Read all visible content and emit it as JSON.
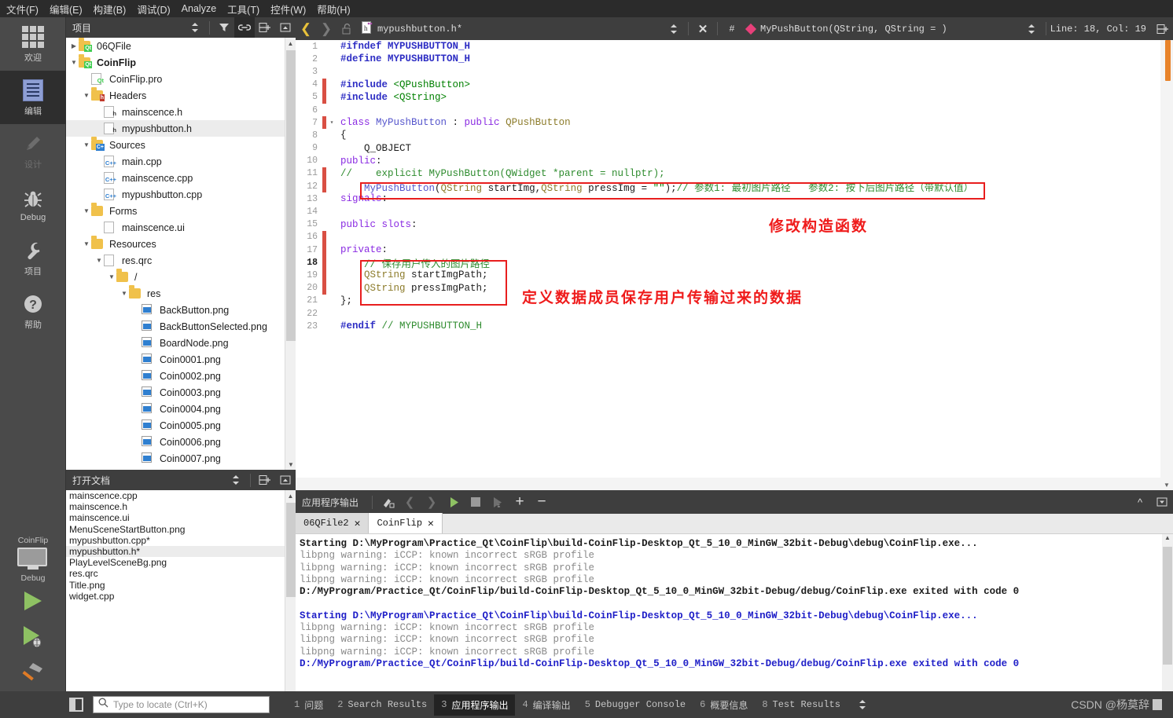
{
  "menubar": [
    {
      "label": "文件(F)"
    },
    {
      "label": "编辑(E)"
    },
    {
      "label": "构建(B)"
    },
    {
      "label": "调试(D)"
    },
    {
      "label": "Analyze"
    },
    {
      "label": "工具(T)"
    },
    {
      "label": "控件(W)"
    },
    {
      "label": "帮助(H)"
    }
  ],
  "modebar": {
    "items": [
      {
        "label": "欢迎",
        "icon": "grid-icon"
      },
      {
        "label": "编辑",
        "icon": "edit-icon"
      },
      {
        "label": "设计",
        "icon": "pencil-icon"
      },
      {
        "label": "Debug",
        "icon": "bug-icon"
      },
      {
        "label": "项目",
        "icon": "wrench-icon"
      },
      {
        "label": "帮助",
        "icon": "question-icon"
      }
    ],
    "kit": {
      "project": "CoinFlip",
      "build_config": "Debug"
    }
  },
  "project_pane": {
    "title": "项目",
    "tree": [
      {
        "indent": 0,
        "arrow": "right",
        "icon": "qt-folder",
        "label": "06QFile",
        "bold": false,
        "sel": false
      },
      {
        "indent": 0,
        "arrow": "down",
        "icon": "qt-folder",
        "label": "CoinFlip",
        "bold": true,
        "sel": false
      },
      {
        "indent": 1,
        "arrow": "",
        "icon": "qt-file",
        "label": "CoinFlip.pro",
        "bold": false,
        "sel": false
      },
      {
        "indent": 1,
        "arrow": "down",
        "icon": "h-folder",
        "label": "Headers",
        "bold": false,
        "sel": false
      },
      {
        "indent": 2,
        "arrow": "",
        "icon": "h-file",
        "label": "mainscence.h",
        "bold": false,
        "sel": false
      },
      {
        "indent": 2,
        "arrow": "",
        "icon": "h-file",
        "label": "mypushbutton.h",
        "bold": false,
        "sel": true
      },
      {
        "indent": 1,
        "arrow": "down",
        "icon": "cpp-folder",
        "label": "Sources",
        "bold": false,
        "sel": false
      },
      {
        "indent": 2,
        "arrow": "",
        "icon": "cpp-file",
        "label": "main.cpp",
        "bold": false,
        "sel": false
      },
      {
        "indent": 2,
        "arrow": "",
        "icon": "cpp-file",
        "label": "mainscence.cpp",
        "bold": false,
        "sel": false
      },
      {
        "indent": 2,
        "arrow": "",
        "icon": "cpp-file",
        "label": "mypushbutton.cpp",
        "bold": false,
        "sel": false
      },
      {
        "indent": 1,
        "arrow": "down",
        "icon": "form-folder",
        "label": "Forms",
        "bold": false,
        "sel": false
      },
      {
        "indent": 2,
        "arrow": "",
        "icon": "ui-file",
        "label": "mainscence.ui",
        "bold": false,
        "sel": false
      },
      {
        "indent": 1,
        "arrow": "down",
        "icon": "res-folder",
        "label": "Resources",
        "bold": false,
        "sel": false
      },
      {
        "indent": 2,
        "arrow": "down",
        "icon": "qrc-file",
        "label": "res.qrc",
        "bold": false,
        "sel": false
      },
      {
        "indent": 3,
        "arrow": "down",
        "icon": "plain-folder",
        "label": "/",
        "bold": false,
        "sel": false
      },
      {
        "indent": 4,
        "arrow": "down",
        "icon": "plain-folder",
        "label": "res",
        "bold": false,
        "sel": false
      },
      {
        "indent": 5,
        "arrow": "",
        "icon": "png-file",
        "label": "BackButton.png",
        "bold": false,
        "sel": false
      },
      {
        "indent": 5,
        "arrow": "",
        "icon": "png-file",
        "label": "BackButtonSelected.png",
        "bold": false,
        "sel": false
      },
      {
        "indent": 5,
        "arrow": "",
        "icon": "png-file",
        "label": "BoardNode.png",
        "bold": false,
        "sel": false
      },
      {
        "indent": 5,
        "arrow": "",
        "icon": "png-file",
        "label": "Coin0001.png",
        "bold": false,
        "sel": false
      },
      {
        "indent": 5,
        "arrow": "",
        "icon": "png-file",
        "label": "Coin0002.png",
        "bold": false,
        "sel": false
      },
      {
        "indent": 5,
        "arrow": "",
        "icon": "png-file",
        "label": "Coin0003.png",
        "bold": false,
        "sel": false
      },
      {
        "indent": 5,
        "arrow": "",
        "icon": "png-file",
        "label": "Coin0004.png",
        "bold": false,
        "sel": false
      },
      {
        "indent": 5,
        "arrow": "",
        "icon": "png-file",
        "label": "Coin0005.png",
        "bold": false,
        "sel": false
      },
      {
        "indent": 5,
        "arrow": "",
        "icon": "png-file",
        "label": "Coin0006.png",
        "bold": false,
        "sel": false
      },
      {
        "indent": 5,
        "arrow": "",
        "icon": "png-file",
        "label": "Coin0007.png",
        "bold": false,
        "sel": false
      }
    ]
  },
  "open_documents": {
    "title": "打开文档",
    "items": [
      {
        "label": "mainscence.cpp",
        "sel": false
      },
      {
        "label": "mainscence.h",
        "sel": false
      },
      {
        "label": "mainscence.ui",
        "sel": false
      },
      {
        "label": "MenuSceneStartButton.png",
        "sel": false
      },
      {
        "label": "mypushbutton.cpp*",
        "sel": false
      },
      {
        "label": "mypushbutton.h*",
        "sel": true
      },
      {
        "label": "PlayLevelSceneBg.png",
        "sel": false
      },
      {
        "label": "res.qrc",
        "sel": false
      },
      {
        "label": "Title.png",
        "sel": false
      },
      {
        "label": "widget.cpp",
        "sel": false
      }
    ]
  },
  "editor_toolbar": {
    "filename": "mypushbutton.h*",
    "hash": "#",
    "symbol": "MyPushButton(QString, QString = )",
    "line_col": "Line: 18, Col: 19"
  },
  "code": {
    "lines": [
      {
        "n": "1",
        "modified": false,
        "fold": "",
        "current": false,
        "tokens": [
          {
            "t": "#ifndef MYPUSHBUTTON_H",
            "c": "pre"
          }
        ]
      },
      {
        "n": "2",
        "modified": false,
        "fold": "",
        "current": false,
        "tokens": [
          {
            "t": "#define MYPUSHBUTTON_H",
            "c": "pre"
          }
        ]
      },
      {
        "n": "3",
        "modified": false,
        "fold": "",
        "current": false,
        "tokens": [
          {
            "t": "",
            "c": "var"
          }
        ]
      },
      {
        "n": "4",
        "modified": true,
        "fold": "",
        "current": false,
        "tokens": [
          {
            "t": "#include ",
            "c": "pre"
          },
          {
            "t": "<QPushButton>",
            "c": "str"
          }
        ]
      },
      {
        "n": "5",
        "modified": true,
        "fold": "",
        "current": false,
        "tokens": [
          {
            "t": "#include ",
            "c": "pre"
          },
          {
            "t": "<QString>",
            "c": "str"
          }
        ]
      },
      {
        "n": "6",
        "modified": false,
        "fold": "",
        "current": false,
        "tokens": [
          {
            "t": "",
            "c": "var"
          }
        ]
      },
      {
        "n": "7",
        "modified": true,
        "fold": "▾",
        "current": false,
        "tokens": [
          {
            "t": "class ",
            "c": "kw"
          },
          {
            "t": "MyPushButton",
            "c": "cls"
          },
          {
            "t": " : ",
            "c": "var"
          },
          {
            "t": "public ",
            "c": "kw"
          },
          {
            "t": "QPushButton",
            "c": "typ"
          }
        ]
      },
      {
        "n": "8",
        "modified": false,
        "fold": "",
        "current": false,
        "tokens": [
          {
            "t": "{",
            "c": "var"
          }
        ]
      },
      {
        "n": "9",
        "modified": false,
        "fold": "",
        "current": false,
        "tokens": [
          {
            "t": "    Q_OBJECT",
            "c": "var"
          }
        ]
      },
      {
        "n": "10",
        "modified": false,
        "fold": "",
        "current": false,
        "tokens": [
          {
            "t": "public",
            "c": "kw"
          },
          {
            "t": ":",
            "c": "var"
          }
        ]
      },
      {
        "n": "11",
        "modified": true,
        "fold": "",
        "current": false,
        "tokens": [
          {
            "t": "//    explicit MyPushButton(QWidget *parent = nullptr);",
            "c": "cmt"
          }
        ]
      },
      {
        "n": "12",
        "modified": true,
        "fold": "",
        "current": false,
        "tokens": [
          {
            "t": "    ",
            "c": "var"
          },
          {
            "t": "MyPushButton",
            "c": "cls"
          },
          {
            "t": "(",
            "c": "var"
          },
          {
            "t": "QString",
            "c": "typ"
          },
          {
            "t": " startImg,",
            "c": "var"
          },
          {
            "t": "QString",
            "c": "typ"
          },
          {
            "t": " pressImg = ",
            "c": "var"
          },
          {
            "t": "\"\"",
            "c": "str"
          },
          {
            "t": ");",
            "c": "var"
          },
          {
            "t": "// 参数1: 最初图片路径   参数2: 按下后图片路径（带默认值）",
            "c": "cmt"
          }
        ]
      },
      {
        "n": "13",
        "modified": false,
        "fold": "",
        "current": false,
        "tokens": [
          {
            "t": "signals",
            "c": "kw"
          },
          {
            "t": ":",
            "c": "var"
          }
        ]
      },
      {
        "n": "14",
        "modified": false,
        "fold": "",
        "current": false,
        "tokens": [
          {
            "t": "",
            "c": "var"
          }
        ]
      },
      {
        "n": "15",
        "modified": false,
        "fold": "",
        "current": false,
        "tokens": [
          {
            "t": "public slots",
            "c": "kw"
          },
          {
            "t": ":",
            "c": "var"
          }
        ]
      },
      {
        "n": "16",
        "modified": true,
        "fold": "",
        "current": false,
        "tokens": [
          {
            "t": "",
            "c": "var"
          }
        ]
      },
      {
        "n": "17",
        "modified": true,
        "fold": "",
        "current": false,
        "tokens": [
          {
            "t": "private",
            "c": "kw"
          },
          {
            "t": ":",
            "c": "var"
          }
        ]
      },
      {
        "n": "18",
        "modified": true,
        "fold": "",
        "current": true,
        "tokens": [
          {
            "t": "    ",
            "c": "var"
          },
          {
            "t": "// 保存用户传入的图片路径",
            "c": "cmt"
          }
        ]
      },
      {
        "n": "19",
        "modified": true,
        "fold": "",
        "current": false,
        "tokens": [
          {
            "t": "    ",
            "c": "var"
          },
          {
            "t": "QString",
            "c": "typ"
          },
          {
            "t": " startImgPath;",
            "c": "var"
          }
        ]
      },
      {
        "n": "20",
        "modified": true,
        "fold": "",
        "current": false,
        "tokens": [
          {
            "t": "    ",
            "c": "var"
          },
          {
            "t": "QString",
            "c": "typ"
          },
          {
            "t": " pressImgPath;",
            "c": "var"
          }
        ]
      },
      {
        "n": "21",
        "modified": false,
        "fold": "",
        "current": false,
        "tokens": [
          {
            "t": "};",
            "c": "var"
          }
        ]
      },
      {
        "n": "22",
        "modified": false,
        "fold": "",
        "current": false,
        "tokens": [
          {
            "t": "",
            "c": "var"
          }
        ]
      },
      {
        "n": "23",
        "modified": false,
        "fold": "",
        "current": false,
        "tokens": [
          {
            "t": "#endif ",
            "c": "pre"
          },
          {
            "t": "// MYPUSHBUTTON_H",
            "c": "cmt"
          }
        ]
      }
    ],
    "annotations": [
      {
        "text": "修改构造函数"
      },
      {
        "text": "定义数据成员保存用户传输过来的数据"
      }
    ],
    "accent_red": "#e81e1e"
  },
  "output_pane": {
    "title": "应用程序输出",
    "tabs": [
      {
        "label": "06QFile2",
        "active": false
      },
      {
        "label": "CoinFlip",
        "active": true
      }
    ],
    "lines": [
      {
        "text": "Starting D:\\MyProgram\\Practice_Qt\\CoinFlip\\build-CoinFlip-Desktop_Qt_5_10_0_MinGW_32bit-Debug\\debug\\CoinFlip.exe...",
        "style": "blk"
      },
      {
        "text": "libpng warning: iCCP: known incorrect sRGB profile",
        "style": ""
      },
      {
        "text": "libpng warning: iCCP: known incorrect sRGB profile",
        "style": ""
      },
      {
        "text": "libpng warning: iCCP: known incorrect sRGB profile",
        "style": ""
      },
      {
        "text": "D:/MyProgram/Practice_Qt/CoinFlip/build-CoinFlip-Desktop_Qt_5_10_0_MinGW_32bit-Debug/debug/CoinFlip.exe exited with code 0",
        "style": "blk"
      },
      {
        "text": "",
        "style": ""
      },
      {
        "text": "Starting D:\\MyProgram\\Practice_Qt\\CoinFlip\\build-CoinFlip-Desktop_Qt_5_10_0_MinGW_32bit-Debug\\debug\\CoinFlip.exe...",
        "style": "blue"
      },
      {
        "text": "libpng warning: iCCP: known incorrect sRGB profile",
        "style": ""
      },
      {
        "text": "libpng warning: iCCP: known incorrect sRGB profile",
        "style": ""
      },
      {
        "text": "libpng warning: iCCP: known incorrect sRGB profile",
        "style": ""
      },
      {
        "text": "D:/MyProgram/Practice_Qt/CoinFlip/build-CoinFlip-Desktop_Qt_5_10_0_MinGW_32bit-Debug/debug/CoinFlip.exe exited with code 0",
        "style": "blue"
      }
    ]
  },
  "statusbar": {
    "locate_placeholder": "Type to locate (Ctrl+K)",
    "panes": [
      {
        "num": "1",
        "label": "问题",
        "active": false
      },
      {
        "num": "2",
        "label": "Search Results",
        "active": false
      },
      {
        "num": "3",
        "label": "应用程序输出",
        "active": true
      },
      {
        "num": "4",
        "label": "编译输出",
        "active": false
      },
      {
        "num": "5",
        "label": "Debugger Console",
        "active": false
      },
      {
        "num": "6",
        "label": "概要信息",
        "active": false
      },
      {
        "num": "8",
        "label": "Test Results",
        "active": false
      }
    ],
    "watermark": "CSDN @杨莫辞"
  }
}
